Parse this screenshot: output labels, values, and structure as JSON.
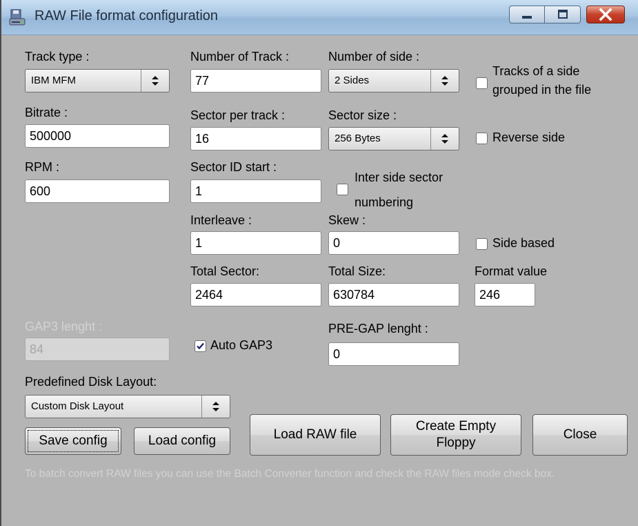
{
  "window": {
    "title": "RAW File format configuration",
    "icon": "floppy-drive-icon",
    "controls": {
      "minimize": "minimize-icon",
      "maximize": "maximize-icon",
      "close": "close-icon"
    }
  },
  "fields": {
    "track_type": {
      "label": "Track type :",
      "value": "IBM MFM"
    },
    "number_of_track": {
      "label": "Number of Track :",
      "value": "77"
    },
    "number_of_side": {
      "label": "Number of side :",
      "value": "2 Sides"
    },
    "tracks_grouped": {
      "label_line1": "Tracks of a side",
      "label_line2": "grouped in the file",
      "checked": false
    },
    "bitrate": {
      "label": "Bitrate :",
      "value": "500000"
    },
    "sector_per_track": {
      "label": "Sector per track :",
      "value": "16"
    },
    "sector_size": {
      "label": "Sector size :",
      "value": "256 Bytes"
    },
    "reverse_side": {
      "label": "Reverse side",
      "checked": false
    },
    "rpm": {
      "label": "RPM :",
      "value": "600"
    },
    "sector_id_start": {
      "label": "Sector ID start :",
      "value": "1"
    },
    "inter_side_numbering": {
      "label_line1": "Inter side sector",
      "label_line2": "numbering",
      "checked": false
    },
    "interleave": {
      "label": "Interleave :",
      "value": "1"
    },
    "skew": {
      "label": "Skew :",
      "value": "0"
    },
    "side_based": {
      "label": "Side based",
      "checked": false
    },
    "total_sector": {
      "label": "Total Sector:",
      "value": "2464"
    },
    "total_size": {
      "label": "Total Size:",
      "value": "630784"
    },
    "format_value": {
      "label": "Format value",
      "value": "246"
    },
    "gap3_length": {
      "label": "GAP3 lenght :",
      "value": "84",
      "disabled": true
    },
    "auto_gap3": {
      "label": "Auto GAP3",
      "checked": true
    },
    "pregap_length": {
      "label": "PRE-GAP lenght :",
      "value": "0"
    },
    "predefined_layout": {
      "label": "Predefined Disk Layout:",
      "value": "Custom Disk Layout"
    }
  },
  "buttons": {
    "save_config": "Save config",
    "load_config": "Load config",
    "load_raw": "Load RAW file",
    "create_empty_line1": "Create Empty",
    "create_empty_line2": "Floppy",
    "close": "Close"
  },
  "hint": "To batch convert RAW files you can use the Batch Converter function and check the RAW files mode check box."
}
